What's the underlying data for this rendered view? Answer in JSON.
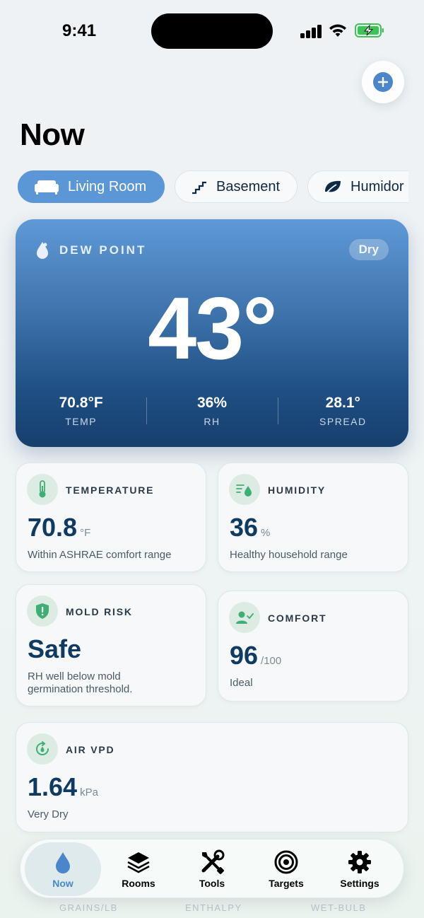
{
  "status_bar": {
    "time": "9:41"
  },
  "header": {
    "title": "Now"
  },
  "rooms": [
    {
      "label": "Living Room",
      "icon": "sofa-icon",
      "active": true
    },
    {
      "label": "Basement",
      "icon": "stairs-icon",
      "active": false
    },
    {
      "label": "Humidor",
      "icon": "leaf-icon",
      "active": false
    }
  ],
  "hero": {
    "label": "DEW POINT",
    "badge": "Dry",
    "value": "43°",
    "stats": [
      {
        "value": "70.8°F",
        "label": "TEMP"
      },
      {
        "value": "36%",
        "label": "RH"
      },
      {
        "value": "28.1°",
        "label": "SPREAD"
      }
    ]
  },
  "cards": {
    "temperature": {
      "label": "TEMPERATURE",
      "value": "70.8",
      "unit": "°F",
      "desc": "Within ASHRAE comfort range"
    },
    "humidity": {
      "label": "HUMIDITY",
      "value": "36",
      "unit": "%",
      "desc": "Healthy household range"
    },
    "mold": {
      "label": "MOLD RISK",
      "value": "Safe",
      "desc_line1": "RH well below mold",
      "desc_line2": "germination threshold."
    },
    "comfort": {
      "label": "COMFORT",
      "value": "96",
      "unit": "/100",
      "desc": "Ideal"
    },
    "vpd": {
      "label": "AIR VPD",
      "value": "1.64",
      "unit": "kPa",
      "desc": "Very Dry"
    }
  },
  "ghost_labels": [
    "GRAINS/LB",
    "ENTHALPY",
    "WET-BULB"
  ],
  "tabs": [
    {
      "label": "Now",
      "icon": "water-drop-icon",
      "active": true
    },
    {
      "label": "Rooms",
      "icon": "layers-icon",
      "active": false
    },
    {
      "label": "Tools",
      "icon": "wrench-screwdriver-icon",
      "active": false
    },
    {
      "label": "Targets",
      "icon": "target-icon",
      "active": false
    },
    {
      "label": "Settings",
      "icon": "gear-icon",
      "active": false
    }
  ],
  "colors": {
    "accent": "#4a86cc",
    "hero_top": "#5f9ad7",
    "hero_bottom": "#173f6c",
    "icon_bg": "#dcece3",
    "icon_green": "#3fae73"
  }
}
